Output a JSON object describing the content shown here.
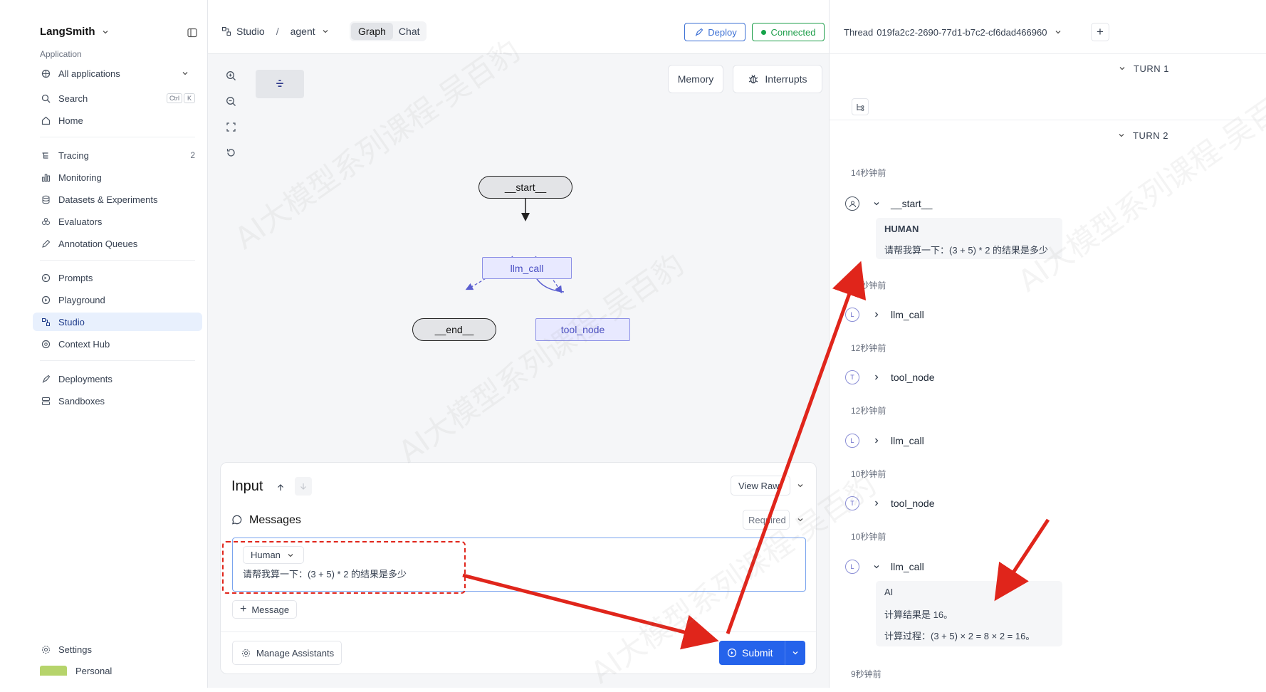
{
  "sidebar": {
    "brand": "LangSmith",
    "section_application": "Application",
    "all_applications": "All applications",
    "search": "Search",
    "search_kbd_ctrl": "Ctrl",
    "search_kbd_k": "K",
    "home": "Home",
    "tracing": "Tracing",
    "tracing_count": "2",
    "monitoring": "Monitoring",
    "datasets": "Datasets & Experiments",
    "evaluators": "Evaluators",
    "annotation_queues": "Annotation Queues",
    "prompts": "Prompts",
    "playground": "Playground",
    "studio": "Studio",
    "context_hub": "Context Hub",
    "deployments": "Deployments",
    "sandboxes": "Sandboxes",
    "settings": "Settings",
    "personal": "Personal"
  },
  "topbar": {
    "studio": "Studio",
    "separator": "/",
    "agent": "agent",
    "tab_graph": "Graph",
    "tab_chat": "Chat",
    "deploy": "Deploy",
    "connected": "Connected"
  },
  "canvas": {
    "memory": "Memory",
    "interrupts": "Interrupts",
    "nodes": {
      "start": "__start__",
      "llm_call": "llm_call",
      "end": "__end__",
      "tool_node": "tool_node"
    }
  },
  "input": {
    "title": "Input",
    "view_raw": "View Raw",
    "messages": "Messages",
    "required": "Required",
    "role": "Human",
    "message_text": "请帮我算一下：(3 + 5) * 2 的结果是多少",
    "add_message": "Message",
    "manage_assistants": "Manage Assistants",
    "submit": "Submit"
  },
  "thread": {
    "label": "Thread",
    "id": "019fa2c2-2690-77d1-b7c2-cf6dad466960",
    "turn1": "TURN 1",
    "turn2": "TURN 2",
    "steps": [
      {
        "time": "14秒钟前",
        "badge": "",
        "name": "__start__"
      },
      {
        "time": "14秒钟前",
        "badge": "L",
        "name": "llm_call"
      },
      {
        "time": "12秒钟前",
        "badge": "T",
        "name": "tool_node"
      },
      {
        "time": "12秒钟前",
        "badge": "L",
        "name": "llm_call"
      },
      {
        "time": "10秒钟前",
        "badge": "T",
        "name": "tool_node"
      },
      {
        "time": "10秒钟前",
        "badge": "L",
        "name": "llm_call"
      },
      {
        "time": "9秒钟前",
        "badge": "",
        "name": ""
      }
    ],
    "human_label": "HUMAN",
    "human_text": "请帮我算一下：(3 + 5) * 2 的结果是多少",
    "ai_label": "AI",
    "ai_line1": "计算结果是 16。",
    "ai_line2": "计算过程：(3 + 5) × 2 = 8 × 2 = 16。"
  },
  "watermark": "AI大模型系列课程-吴百豹",
  "colors": {
    "accent": "#2563eb",
    "active_bg": "#e8f0fd",
    "node_purple": "#6b6fd4",
    "annotation_red": "#e0251b",
    "connected_green": "#16a34a"
  }
}
